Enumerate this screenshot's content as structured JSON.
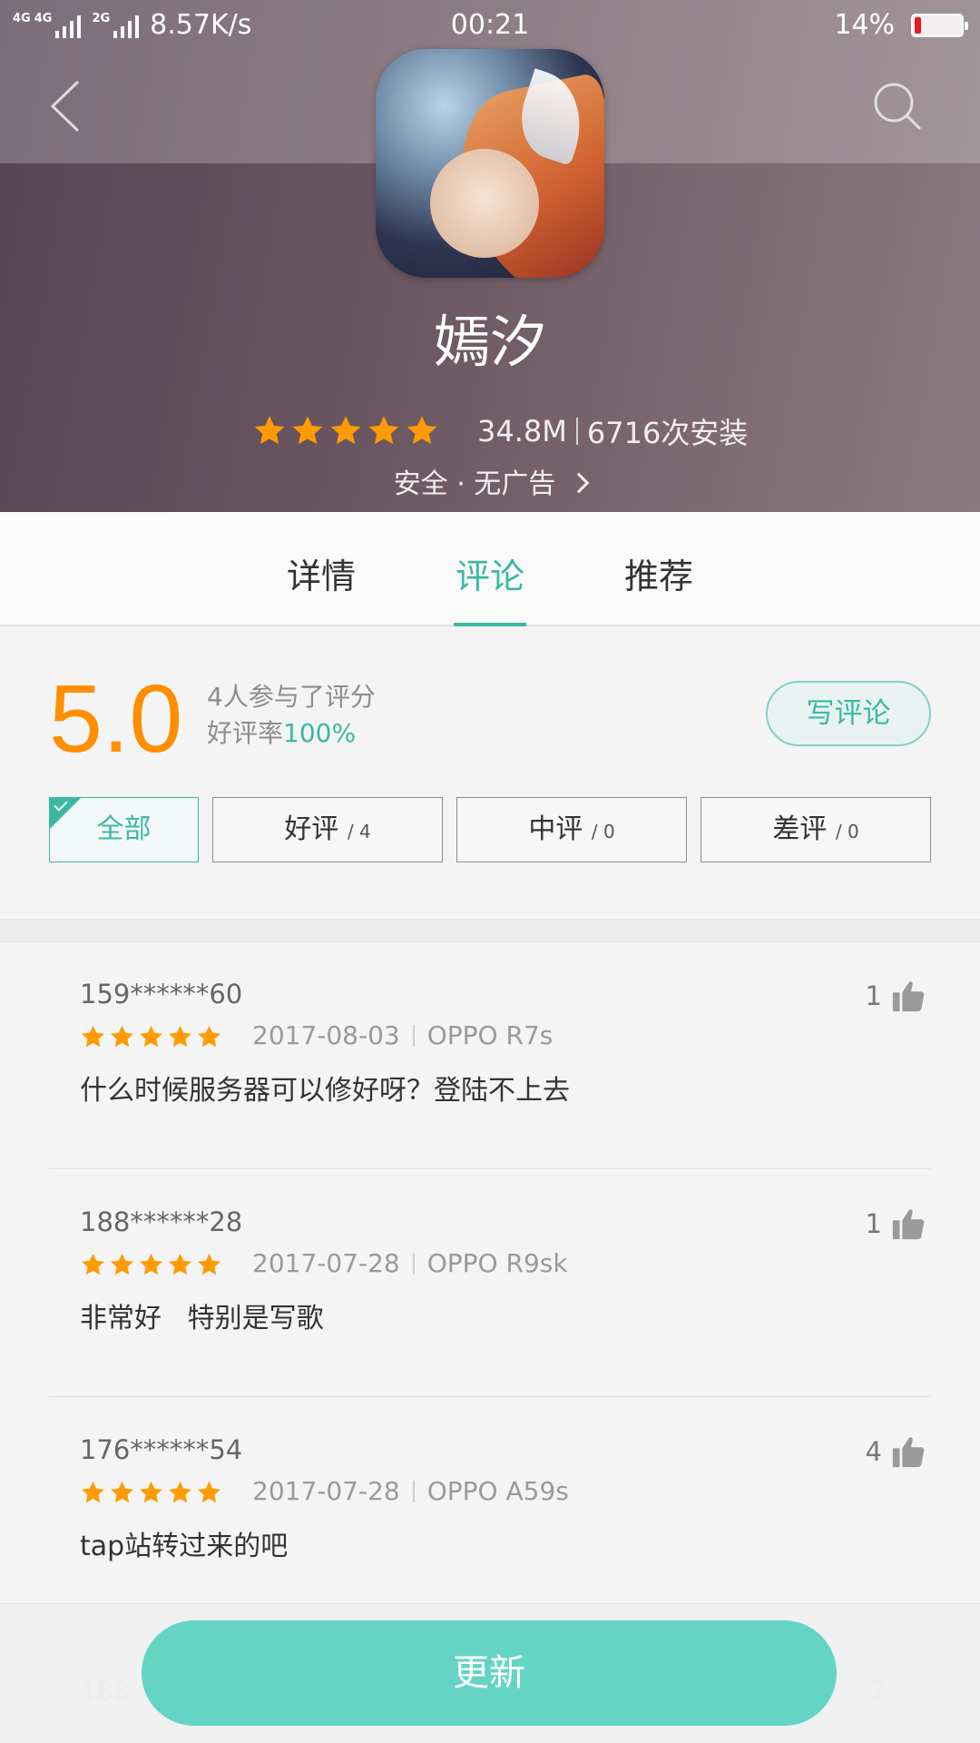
{
  "status_bar": {
    "network_1": "4G",
    "network_2": "4G",
    "network_3": "2G",
    "speed": "8.57K/s",
    "time": "00:21",
    "battery": "14%",
    "battery_level": 0.14
  },
  "app": {
    "name": "嫣汐",
    "rating_stars": 5,
    "size": "34.8M",
    "installs": "6716次安装",
    "safety": "安全 · 无广告"
  },
  "tabs": [
    {
      "label": "详情"
    },
    {
      "label": "评论"
    },
    {
      "label": "推荐"
    }
  ],
  "active_tab": "评论",
  "summary": {
    "score": "5.0",
    "participants": "4人参与了评分",
    "positive_label": "好评率",
    "positive_pct": "100%",
    "write_review": "写评论"
  },
  "filters": [
    {
      "label": "全部",
      "count": ""
    },
    {
      "label": "好评",
      "count": "/ 4"
    },
    {
      "label": "中评",
      "count": "/ 0"
    },
    {
      "label": "差评",
      "count": "/ 0"
    }
  ],
  "comments": [
    {
      "user": "159******60",
      "stars": 5,
      "date": "2017-08-03",
      "device": "OPPO R7s",
      "text": "什么时候服务器可以修好呀？登陆不上去",
      "likes": "1"
    },
    {
      "user": "188******28",
      "stars": 5,
      "date": "2017-07-28",
      "device": "OPPO R9sk",
      "text": "非常好   特别是写歌",
      "likes": "1"
    },
    {
      "user": "176******54",
      "stars": 5,
      "date": "2017-07-28",
      "device": "OPPO A59s",
      "text": "tap站转过来的吧",
      "likes": "4"
    }
  ],
  "partial_next": {
    "user": "188",
    "likes": "2"
  },
  "bottom": {
    "update": "更新"
  },
  "colors": {
    "accent": "#3bb8a4",
    "star": "#ff9b00",
    "score": "#ff8f00",
    "update_button": "#64d5c4"
  }
}
